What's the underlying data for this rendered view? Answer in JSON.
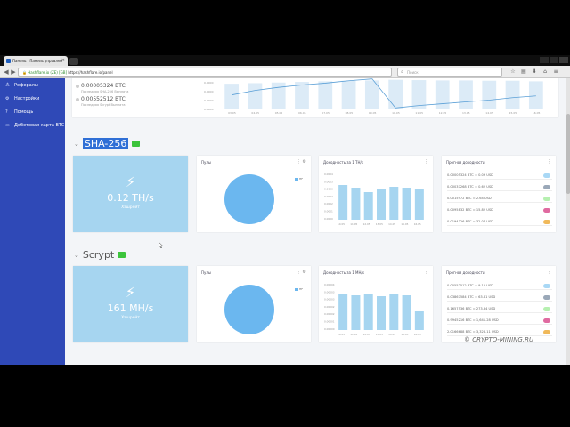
{
  "browser": {
    "tab_title": "Панель | Панель управлен",
    "address_prefix": "Hashflare.io (ZE) [GB]",
    "url": "https://hashflare.io/panel",
    "search_placeholder": "Поиск"
  },
  "sidebar": {
    "items": [
      {
        "label": "Рефералы",
        "icon": "users-icon"
      },
      {
        "label": "Настройки",
        "icon": "gear-icon"
      },
      {
        "label": "Помощь",
        "icon": "help-icon"
      },
      {
        "label": "Дебетовая карта BTC",
        "icon": "card-icon"
      }
    ]
  },
  "balances": [
    {
      "value": "0.00005324 BTC",
      "label": "Последняя SHA-256 Выплата"
    },
    {
      "value": "0.00552512 BTC",
      "label": "Последняя Scrypt Выплата"
    }
  ],
  "top_chart": {
    "x_labels": [
      "03.05",
      "04.05",
      "05.05",
      "06.05",
      "07.05",
      "08.05",
      "09.05",
      "10.05",
      "11.05",
      "12.05",
      "13.05",
      "14.05",
      "15.05",
      "16.05"
    ],
    "y_labels": [
      "0.0000",
      "0.0000",
      "0.0000",
      "0.0000"
    ],
    "bar_values": [
      0.82,
      0.84,
      0.86,
      0.88,
      0.9,
      0.92,
      0.93,
      0.95,
      0.94,
      0.93,
      0.93,
      0.92,
      0.92,
      0.9
    ],
    "line_values": [
      0.45,
      0.6,
      0.7,
      0.78,
      0.84,
      0.92,
      0.98,
      0.02,
      0.1,
      0.16,
      0.22,
      0.28,
      0.36,
      0.42
    ]
  },
  "sections": [
    {
      "title": "SHA-256",
      "hashrate": "0.12 TH/s",
      "hashrate_label": "Хэшрейт",
      "pools_title": "Пулы",
      "pool_legend": "HF",
      "profit_title": "Доходность за 1 TH/s",
      "profit_y": [
        "0.0004",
        "0.0003",
        "0.0003",
        "0.0002",
        "0.0002",
        "0.0001",
        "0.0000"
      ],
      "profit_x": [
        "10.05",
        "11.05",
        "12.05",
        "13.05",
        "14.05",
        "15.05",
        "16.05"
      ],
      "profit_values": [
        0.78,
        0.72,
        0.62,
        0.7,
        0.74,
        0.72,
        0.7
      ],
      "forecast_title": "Прогноз доходности",
      "forecast": [
        {
          "text": "0.00005324 BTC = 0.09 USD",
          "pill": "#a9d8f5"
        },
        {
          "text": "0.00037268 BTC = 0.62 USD",
          "pill": "#9aa8b8"
        },
        {
          "text": "0.0015972 BTC = 2.64 USD",
          "pill": "#b6f0b0"
        },
        {
          "text": "0.0095832 BTC = 15.82 USD",
          "pill": "#e06aa0"
        },
        {
          "text": "0.0194326 BTC = 32.07 USD",
          "pill": "#f0b95a"
        }
      ]
    },
    {
      "title": "Scrypt",
      "hashrate": "161 MH/s",
      "hashrate_label": "Хэшрейт",
      "pools_title": "Пулы",
      "pool_legend": "HF",
      "profit_title": "Доходность за 1 MH/s",
      "profit_y": [
        "0.00004",
        "0.00003",
        "0.00003",
        "0.00002",
        "0.00002",
        "0.00001",
        "0.00000"
      ],
      "profit_x": [
        "10.05",
        "11.05",
        "12.05",
        "13.05",
        "14.05",
        "15.05",
        "16.05"
      ],
      "profit_values": [
        0.82,
        0.78,
        0.8,
        0.76,
        0.8,
        0.78,
        0.42
      ],
      "forecast_title": "Прогноз доходности",
      "forecast": [
        {
          "text": "0.00552512 BTC = 9.12 USD",
          "pill": "#a9d8f5"
        },
        {
          "text": "0.03867584 BTC = 63.81 USD",
          "pill": "#9aa8b8"
        },
        {
          "text": "0.1657536 BTC = 273.34 USD",
          "pill": "#b6f0b0"
        },
        {
          "text": "0.9945216 BTC = 1,641.28 USD",
          "pill": "#e06aa0"
        },
        {
          "text": "2.0166688 BTC = 3,328.11 USD",
          "pill": "#f0b95a"
        }
      ]
    }
  ],
  "watermark": "CRYPTO-MINING.RU",
  "colors": {
    "sidebar": "#2f49b7",
    "accent": "#6bb7ef",
    "hash_card": "#a6d5f0"
  }
}
